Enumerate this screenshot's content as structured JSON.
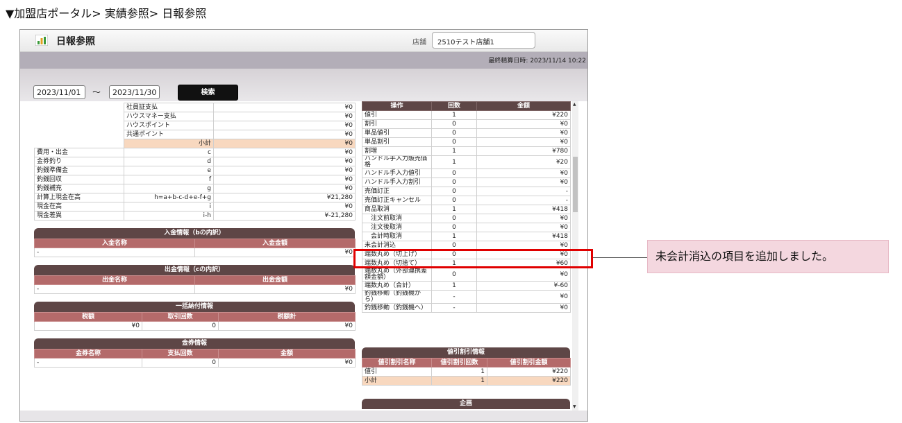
{
  "breadcrumb": "▼加盟店ポータル> 実績参照> 日報参照",
  "page_title": "日報参照",
  "store": {
    "label": "店舗",
    "value": "2510テスト店舗1"
  },
  "last_settlement": "最終精算日時: 2023/11/14 10:22",
  "date_from": "2023/11/01",
  "tilde": "～",
  "date_to": "2023/11/30",
  "search_label": "検索",
  "payment_rows": [
    {
      "name": "社員証支払",
      "amt": "¥0"
    },
    {
      "name": "ハウスマネー支払",
      "amt": "¥0"
    },
    {
      "name": "ハウスポイント",
      "amt": "¥0"
    },
    {
      "name": "共通ポイント",
      "amt": "¥0"
    }
  ],
  "subtotal": {
    "label": "小計",
    "amt": "¥0"
  },
  "cash_rows": [
    {
      "name": "費用・出金",
      "formula": "c",
      "amt": "¥0"
    },
    {
      "name": "金券釣り",
      "formula": "d",
      "amt": "¥0"
    },
    {
      "name": "釣銭準備金",
      "formula": "e",
      "amt": "¥0"
    },
    {
      "name": "釣銭回収",
      "formula": "f",
      "amt": "¥0"
    },
    {
      "name": "釣銭補充",
      "formula": "g",
      "amt": "¥0"
    },
    {
      "name": "計算上現金在高",
      "formula": "h=a+b-c-d+e-f+g",
      "amt": "¥21,280"
    },
    {
      "name": "現金在高",
      "formula": "i",
      "amt": "¥0"
    },
    {
      "name": "現金差異",
      "formula": "i-h",
      "amt": "¥-21,280"
    }
  ],
  "deposit": {
    "title": "入金情報（bの内訳）",
    "col1": "入金名称",
    "col2": "入金金額",
    "row": {
      "name": "-",
      "amt": "¥0"
    }
  },
  "withdraw": {
    "title": "出金情報（cの内訳）",
    "col1": "出金名称",
    "col2": "出金金額",
    "row": {
      "name": "-",
      "amt": "¥0"
    }
  },
  "bulk_tax": {
    "title": "一括納付情報",
    "col1": "税額",
    "col2": "取引回数",
    "col3": "税額計",
    "row": {
      "tax": "¥0",
      "count": "0",
      "total": "¥0"
    }
  },
  "voucher": {
    "title": "金券情報",
    "col1": "金券名称",
    "col2": "支払回数",
    "col3": "金額",
    "row": {
      "name": "-",
      "count": "0",
      "amt": "¥0"
    }
  },
  "ops": {
    "col1": "操作",
    "col2": "回数",
    "col3": "金額",
    "rows": [
      {
        "name": "値引",
        "count": "1",
        "amt": "¥220"
      },
      {
        "name": "割引",
        "count": "0",
        "amt": "¥0"
      },
      {
        "name": "単品値引",
        "count": "0",
        "amt": "¥0"
      },
      {
        "name": "単品割引",
        "count": "0",
        "amt": "¥0"
      },
      {
        "name": "割増",
        "count": "1",
        "amt": "¥780"
      },
      {
        "name": "ハンドル手入力販売価格",
        "count": "1",
        "amt": "¥20"
      },
      {
        "name": "ハンドル手入力値引",
        "count": "0",
        "amt": "¥0"
      },
      {
        "name": "ハンドル手入力割引",
        "count": "0",
        "amt": "¥0"
      },
      {
        "name": "売価訂正",
        "count": "0",
        "amt": "-"
      },
      {
        "name": "売価訂正キャンセル",
        "count": "0",
        "amt": "-"
      },
      {
        "name": "商品取消",
        "count": "1",
        "amt": "¥418"
      },
      {
        "name": "　注文前取消",
        "count": "0",
        "amt": "¥0"
      },
      {
        "name": "　注文後取消",
        "count": "0",
        "amt": "¥0"
      },
      {
        "name": "　会計時取消",
        "count": "1",
        "amt": "¥418"
      },
      {
        "name": "未会計消込",
        "count": "0",
        "amt": "¥0"
      },
      {
        "name": "端数丸め（切上げ）",
        "count": "0",
        "amt": "¥0"
      },
      {
        "name": "端数丸め（切捨て）",
        "count": "1",
        "amt": "¥60"
      },
      {
        "name": "端数丸め（外部連携差額金額）",
        "count": "0",
        "amt": "¥0"
      },
      {
        "name": "端数丸め（合計）",
        "count": "1",
        "amt": "¥-60"
      },
      {
        "name": "釣銭移動（釣銭機から）",
        "count": "-",
        "amt": "¥0"
      },
      {
        "name": "釣銭移動（釣銭機へ）",
        "count": "-",
        "amt": "¥0"
      }
    ]
  },
  "discount": {
    "title": "値引割引情報",
    "col1": "値引割引名称",
    "col2": "値引割引回数",
    "col3": "値引割引金額",
    "rows": [
      {
        "name": "値引",
        "count": "1",
        "amt": "¥220"
      }
    ],
    "subtotal": {
      "name": "小計",
      "count": "1",
      "amt": "¥220"
    }
  },
  "plan_title": "企画",
  "callout": "未会計消込の項目を追加しました。"
}
